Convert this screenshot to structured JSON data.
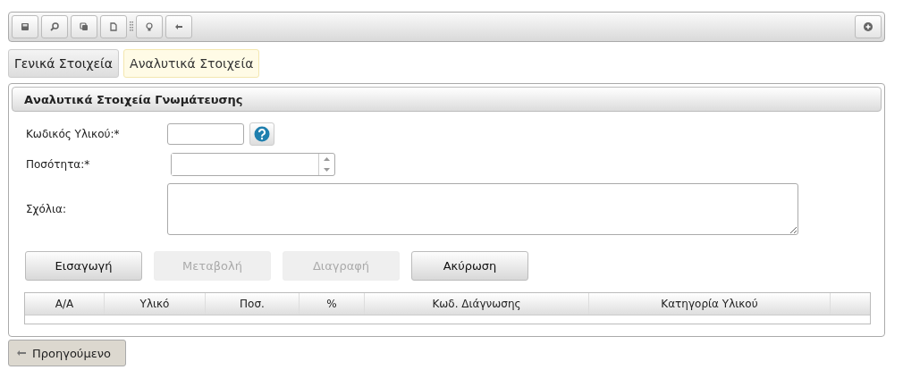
{
  "toolbar": {
    "buttons": [
      {
        "kind": "save"
      },
      {
        "kind": "search"
      },
      {
        "kind": "copy"
      },
      {
        "kind": "new"
      },
      {
        "kind": "grip"
      },
      {
        "kind": "bulb"
      },
      {
        "kind": "back"
      }
    ],
    "right_buttons": [
      {
        "kind": "add"
      }
    ]
  },
  "tabs": [
    {
      "label": "Γενικά Στοιχεία",
      "selected": false
    },
    {
      "label": "Αναλυτικά Στοιχεία",
      "selected": true
    }
  ],
  "panel": {
    "title": "Αναλυτικά Στοιχεία Γνωμάτευσης",
    "fields": [
      {
        "label": "Κωδικός Υλικού:*",
        "kind": "text-help"
      },
      {
        "label": "Ποσότητα:*",
        "kind": "spinner"
      },
      {
        "label": "Σχόλια:",
        "kind": "textarea"
      }
    ],
    "buttons": [
      {
        "label": "Εισαγωγή",
        "disabled": false
      },
      {
        "label": "Μεταβολή",
        "disabled": true
      },
      {
        "label": "Διαγραφή",
        "disabled": true
      },
      {
        "label": "Ακύρωση",
        "disabled": false
      }
    ],
    "table": {
      "columns": [
        "Α/Α",
        "Υλικό",
        "Ποσ.",
        "%",
        "Κωδ. Διάγνωσης",
        "Κατηγορία Υλικού",
        ""
      ]
    }
  },
  "back_button": {
    "label": "Προηγούμενο"
  }
}
